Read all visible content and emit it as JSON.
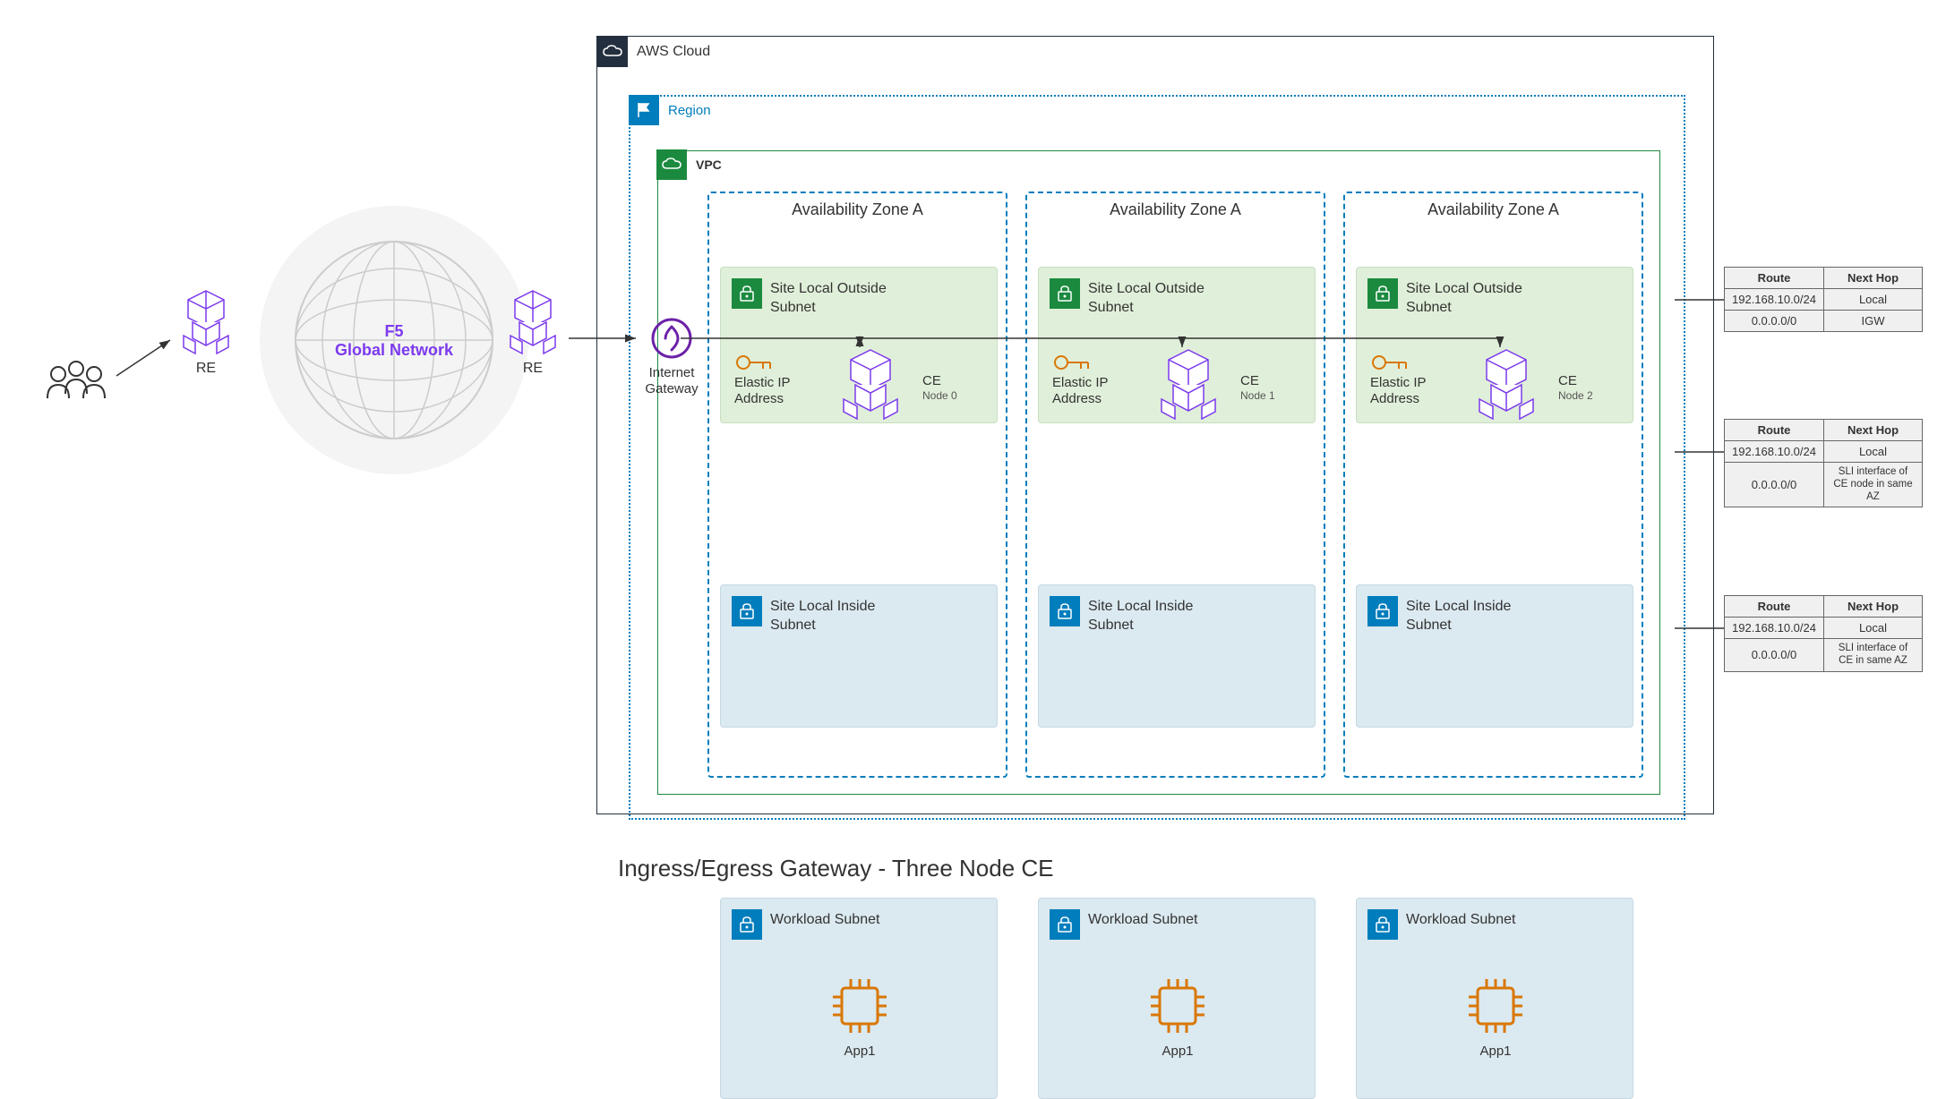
{
  "users_label": "",
  "re_label": "RE",
  "globe": {
    "line1": "F5",
    "line2": "Global Network"
  },
  "igw_label": "Internet\nGateway",
  "aws_cloud_label": "AWS Cloud",
  "region_label": "Region",
  "vpc_label": "VPC",
  "az": [
    {
      "title": "Availability Zone A",
      "outside": "Site Local Outside\nSubnet",
      "eip": "Elastic IP\nAddress",
      "ce": "CE",
      "ce_node": "Node 0",
      "inside": "Site Local Inside\nSubnet",
      "workload": "Workload Subnet",
      "app": "App1"
    },
    {
      "title": "Availability Zone A",
      "outside": "Site Local Outside\nSubnet",
      "eip": "Elastic IP\nAddress",
      "ce": "CE",
      "ce_node": "Node 1",
      "inside": "Site Local Inside\nSubnet",
      "workload": "Workload Subnet",
      "app": "App1"
    },
    {
      "title": "Availability Zone A",
      "outside": "Site Local Outside\nSubnet",
      "eip": "Elastic IP\nAddress",
      "ce": "CE",
      "ce_node": "Node 2",
      "inside": "Site Local Inside\nSubnet",
      "workload": "Workload Subnet",
      "app": "App1"
    }
  ],
  "route_tables": [
    {
      "header": [
        "Route",
        "Next Hop"
      ],
      "rows": [
        [
          "192.168.10.0/24",
          "Local"
        ],
        [
          "0.0.0.0/0",
          "IGW"
        ]
      ]
    },
    {
      "header": [
        "Route",
        "Next Hop"
      ],
      "rows": [
        [
          "192.168.10.0/24",
          "Local"
        ],
        [
          "0.0.0.0/0",
          "SLI interface of CE node in same AZ"
        ]
      ]
    },
    {
      "header": [
        "Route",
        "Next Hop"
      ],
      "rows": [
        [
          "192.168.10.0/24",
          "Local"
        ],
        [
          "0.0.0.0/0",
          "SLI interface of CE in same AZ"
        ]
      ]
    }
  ],
  "caption": "Ingress/Egress Gateway - Three Node CE"
}
